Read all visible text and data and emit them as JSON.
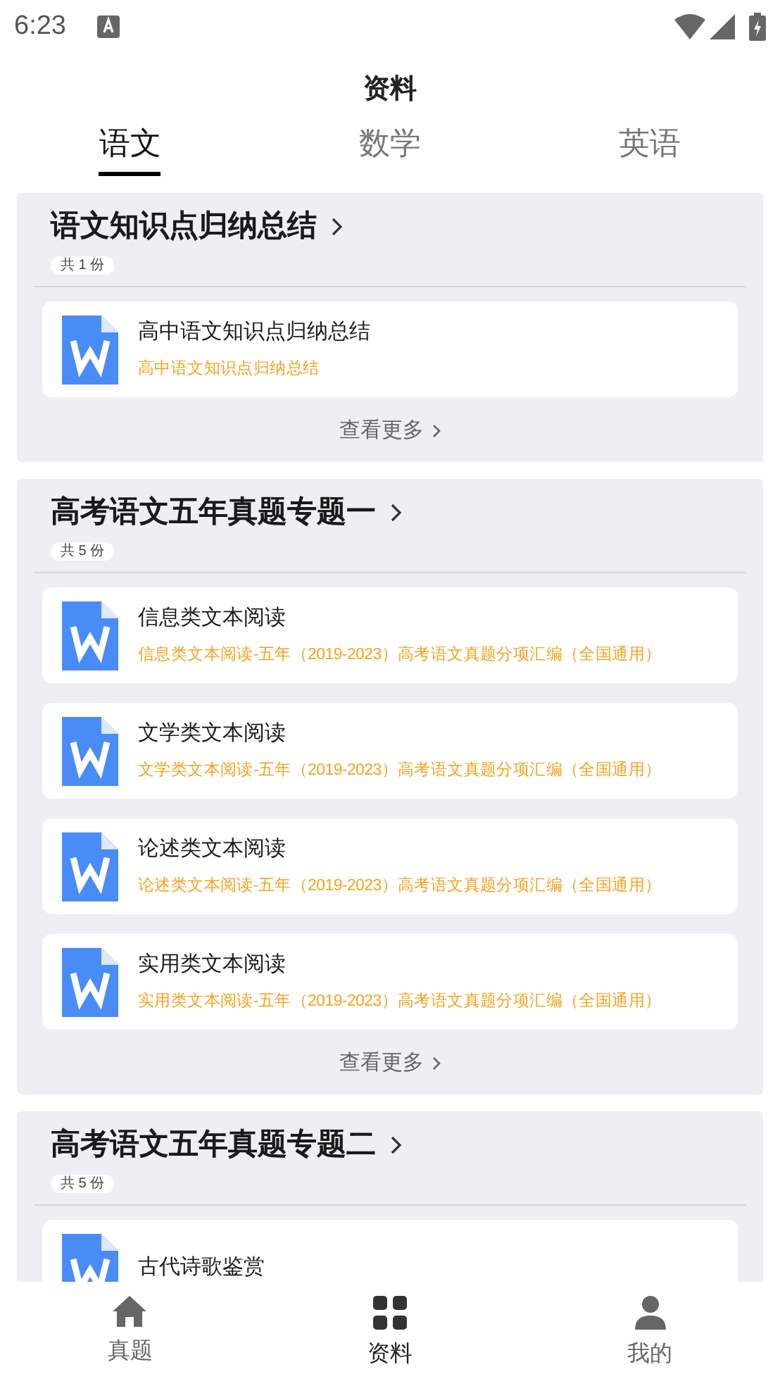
{
  "status_bar": {
    "time": "6:23"
  },
  "title": "资料",
  "tabs": [
    {
      "label": "语文",
      "selected": true
    },
    {
      "label": "数学",
      "selected": false
    },
    {
      "label": "英语",
      "selected": false
    }
  ],
  "sections": [
    {
      "title": "语文知识点归纳总结",
      "count": "共 1 份",
      "items": [
        {
          "title": "高中语文知识点归纳总结",
          "subtitle": "高中语文知识点归纳总结"
        }
      ],
      "more": "查看更多"
    },
    {
      "title": "高考语文五年真题专题一",
      "count": "共 5 份",
      "items": [
        {
          "title": "信息类文本阅读",
          "subtitle": "信息类文本阅读-五年（2019-2023）高考语文真题分项汇编（全国通用）"
        },
        {
          "title": "文学类文本阅读",
          "subtitle": "文学类文本阅读-五年（2019-2023）高考语文真题分项汇编（全国通用）"
        },
        {
          "title": "论述类文本阅读",
          "subtitle": "论述类文本阅读-五年（2019-2023）高考语文真题分项汇编（全国通用）"
        },
        {
          "title": "实用类文本阅读",
          "subtitle": "实用类文本阅读-五年（2019-2023）高考语文真题分项汇编（全国通用）"
        }
      ],
      "more": "查看更多"
    },
    {
      "title": "高考语文五年真题专题二",
      "count": "共 5 份",
      "items": [
        {
          "title": "古代诗歌鉴赏"
        }
      ]
    }
  ],
  "bottom_nav": [
    {
      "label": "真题",
      "kind": "home",
      "selected": false
    },
    {
      "label": "资料",
      "kind": "grid",
      "selected": true
    },
    {
      "label": "我的",
      "kind": "person",
      "selected": false
    }
  ]
}
